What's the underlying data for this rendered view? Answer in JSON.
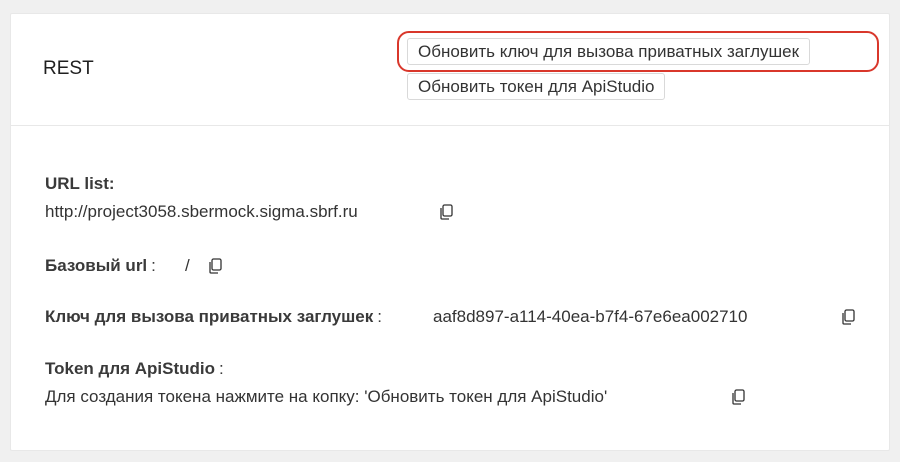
{
  "card": {
    "title": "REST",
    "buttons": {
      "refresh_key": "Обновить ключ для вызова приватных заглушек",
      "refresh_token": "Обновить токен для ApiStudio"
    }
  },
  "fields": {
    "url_list": {
      "label": "URL list:",
      "value": "http://project3058.sbermock.sigma.sbrf.ru"
    },
    "base_url": {
      "label": "Базовый url",
      "sep": ":",
      "value": "/"
    },
    "private_key": {
      "label": "Ключ для вызова приватных заглушек",
      "sep": ":",
      "value": "aaf8d897-a114-40ea-b7f4-67e6ea002710"
    },
    "apistudio_token": {
      "label": "Token для ApiStudio",
      "sep": ":",
      "value": "Для создания токена нажмите на копку: 'Обновить токен для ApiStudio'"
    }
  },
  "colors": {
    "highlight": "#d9372b",
    "border": "#d9d9d9",
    "background": "#f0f0f0"
  },
  "icons": {
    "copy": "copy-icon"
  }
}
